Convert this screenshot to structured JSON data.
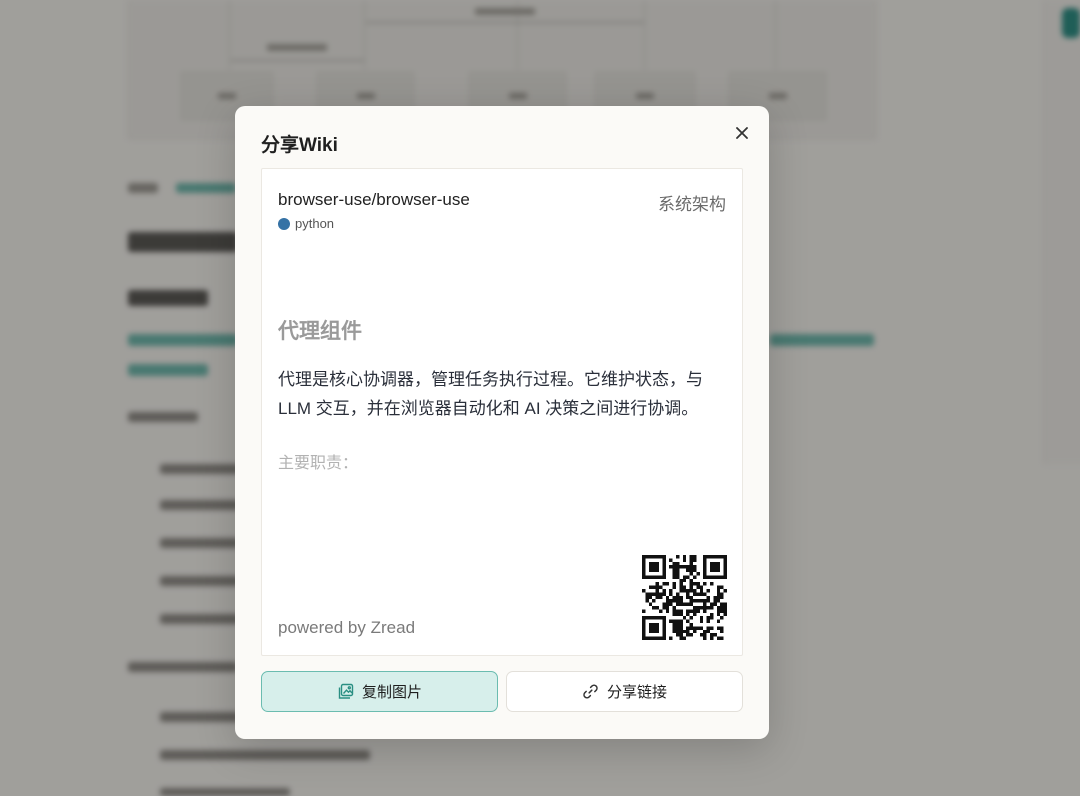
{
  "modal": {
    "title": "分享Wiki",
    "close_icon": "close-icon"
  },
  "card": {
    "repo": "browser-use/browser-use",
    "language": "python",
    "language_color": "#3572A5",
    "section": "系统架构",
    "heading": "代理组件",
    "body": "代理是核心协调器，管理任务执行过程。它维护状态，与 LLM 交互，并在浏览器自动化和 AI 决策之间进行协调。",
    "subheading": "主要职责：",
    "powered_by": "powered by Zread",
    "qr_icon": "qr-code-icon"
  },
  "buttons": {
    "copy_image": "复制图片",
    "copy_image_icon": "image-copy-icon",
    "share_link": "分享链接",
    "share_link_icon": "link-icon"
  },
  "colors": {
    "accent": "#6bbcb0",
    "accent_bg": "#d7efeb"
  }
}
